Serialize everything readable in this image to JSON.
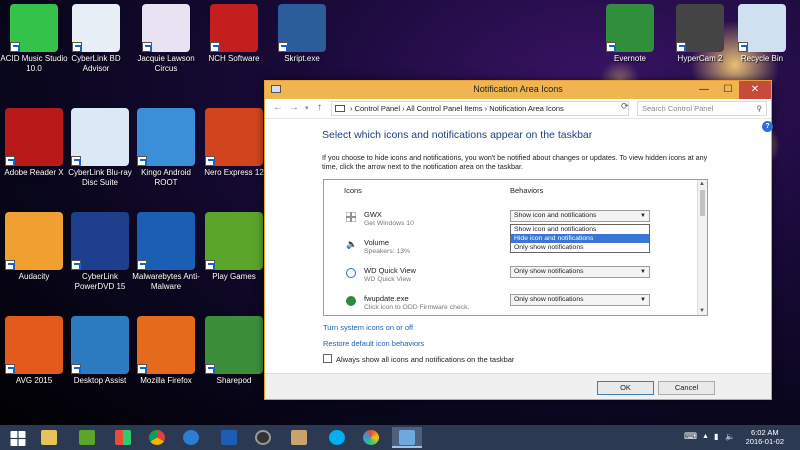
{
  "desktop": {
    "icons": [
      {
        "label": "ACID Music Studio 10.0",
        "icon": "music-note-icon",
        "color": "#35c24a"
      },
      {
        "label": "CyberLink BD Advisor",
        "icon": "disc-icon",
        "color": "#e8eef5"
      },
      {
        "label": "Jacquie Lawson Circus",
        "icon": "circus-icon",
        "color": "#e7e3f3"
      },
      {
        "label": "NCH Software",
        "icon": "nch-logo-icon",
        "color": "#c41e1e"
      },
      {
        "label": "Skript.exe",
        "icon": "k-logo-icon",
        "color": "#2b5d9a"
      },
      {
        "label": "Evernote",
        "icon": "elephant-icon",
        "color": "#2f8f3a"
      },
      {
        "label": "HyperCam 2",
        "icon": "camera-icon",
        "color": "#444444"
      },
      {
        "label": "Recycle Bin",
        "icon": "recycle-bin-icon",
        "color": "#cfe0f0"
      },
      {
        "label": "Adobe Reader X",
        "icon": "pdf-icon",
        "color": "#b81a1a"
      },
      {
        "label": "CyberLink Blu-ray Disc Suite",
        "icon": "upload-arrow-icon",
        "color": "#dbe9f6"
      },
      {
        "label": "Kingo Android ROOT",
        "icon": "kingo-icon",
        "color": "#3a8fd8"
      },
      {
        "label": "Nero Express 12",
        "icon": "nero-icon",
        "color": "#d0451e"
      },
      {
        "label": "Audacity",
        "icon": "audacity-icon",
        "color": "#f0a030"
      },
      {
        "label": "CyberLink PowerDVD 15",
        "icon": "play-icon",
        "color": "#1e3f8e"
      },
      {
        "label": "Malwarebytes Anti-Malware",
        "icon": "malwarebytes-icon",
        "color": "#1b5fb5"
      },
      {
        "label": "Play Games",
        "icon": "games-icon",
        "color": "#5aa52a"
      },
      {
        "label": "AVG 2015",
        "icon": "avg-icon",
        "color": "#e35b1c"
      },
      {
        "label": "Desktop Assist",
        "icon": "desktop-assist-icon",
        "color": "#2c7bc0"
      },
      {
        "label": "Mozilla Firefox",
        "icon": "firefox-icon",
        "color": "#e66a1c"
      },
      {
        "label": "Sharepod",
        "icon": "sharepod-icon",
        "color": "#3b8f3b"
      }
    ]
  },
  "window": {
    "title": "Notification Area Icons",
    "min": "—",
    "max": "☐",
    "close": "✕",
    "breadcrumb": "›  Control Panel  ›  All Control Panel Items  ›  Notification Area Icons",
    "search_placeholder": "Search Control Panel",
    "heading": "Select which icons and notifications appear on the taskbar",
    "description": "If you choose to hide icons and notifications, you won't be notified about changes or updates. To view hidden icons at any time, click the arrow next to the notification area on the taskbar.",
    "col_icons": "Icons",
    "col_behaviors": "Behaviors",
    "rows": [
      {
        "name": "GWX",
        "sub": "Get Windows 10",
        "behavior": "Show icon and notifications",
        "icon": "windows-logo-icon"
      },
      {
        "name": "Volume",
        "sub": "Speakers: 13%",
        "behavior": "",
        "icon": "speaker-icon"
      },
      {
        "name": "WD Quick View",
        "sub": "WD Quick View",
        "behavior": "Only show notifications",
        "icon": "wd-icon"
      },
      {
        "name": "fwupdate.exe",
        "sub": "Click icon to ODD Firmware check.",
        "behavior": "Only show notifications",
        "icon": "firmware-icon"
      }
    ],
    "dropdown_options": [
      "Show icon and notifications",
      "Hide icon and notifications",
      "Only show notifications"
    ],
    "link_system_icons": "Turn system icons on or off",
    "link_restore": "Restore default icon behaviors",
    "always_show": "Always show all icons and notifications on the taskbar",
    "ok": "OK",
    "cancel": "Cancel"
  },
  "taskbar": {
    "time": "6:02 AM",
    "date": "2016-01-02"
  }
}
